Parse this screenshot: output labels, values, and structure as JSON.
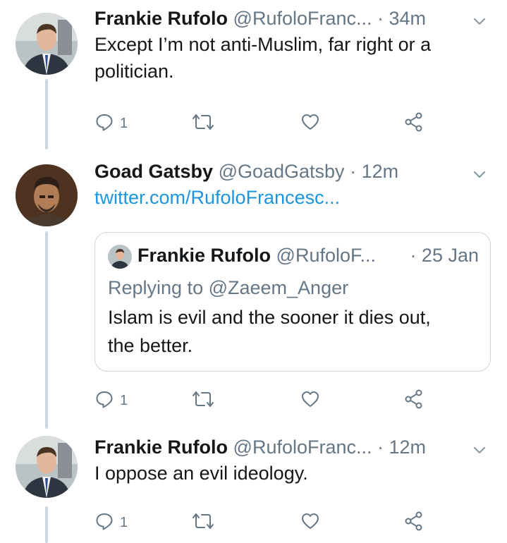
{
  "tweets": [
    {
      "name": "Frankie Rufolo",
      "handle": "@RufoloFranc...",
      "time": "· 34m",
      "text_line1": "Except I’m not anti-Muslim, far right or a",
      "text_line2": "politician.",
      "reply_count": "1"
    },
    {
      "name": "Goad Gatsby",
      "handle": "@GoadGatsby",
      "time": "· 12m",
      "link": "twitter.com/RufoloFrancesc...",
      "quote": {
        "name": "Frankie Rufolo",
        "handle": "@RufoloF...",
        "time": "· 25 Jan",
        "replying_to": "Replying to @Zaeem_Anger",
        "text_line1": "Islam is evil and the sooner it dies out,",
        "text_line2": "the better."
      },
      "reply_count": "1"
    },
    {
      "name": "Frankie Rufolo",
      "handle": "@RufoloFranc...",
      "time": "· 12m",
      "text_line1": "I oppose an evil ideology.",
      "reply_count": "1"
    }
  ],
  "icons": {
    "reply": "reply-icon",
    "retweet": "retweet-icon",
    "like": "heart-icon",
    "share": "share-icon",
    "menu": "chevron-down-icon"
  },
  "colors": {
    "link": "#1b95e0",
    "secondary_text": "#657786",
    "thread_line": "#ccd6dd"
  }
}
